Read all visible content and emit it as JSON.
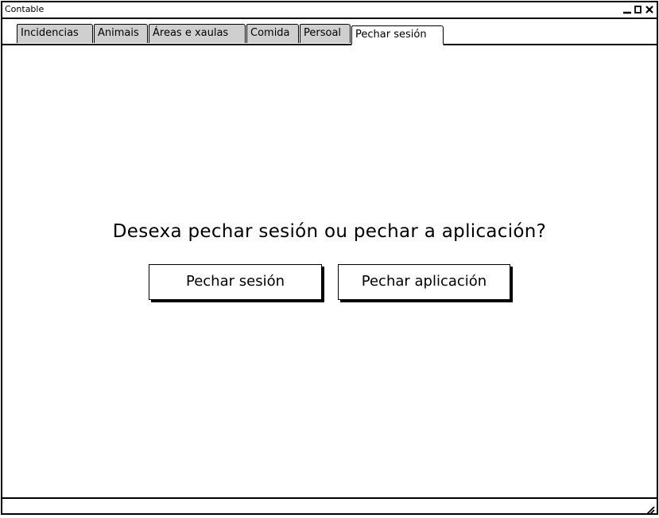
{
  "window": {
    "title": "Contable"
  },
  "window_controls": {
    "minimize_icon": "minimize-icon",
    "maximize_icon": "maximize-icon",
    "close_icon": "close-icon"
  },
  "tabs": [
    {
      "label": "Incidencias",
      "active": false
    },
    {
      "label": "Animais",
      "active": false
    },
    {
      "label": "Áreas e xaulas",
      "active": false
    },
    {
      "label": "Comida",
      "active": false
    },
    {
      "label": "Persoal",
      "active": false
    },
    {
      "label": "Pechar sesión",
      "active": true
    }
  ],
  "main": {
    "question": "Desexa pechar sesión ou pechar a aplicación?",
    "logout_button": "Pechar sesión",
    "exit_button": "Pechar aplicación"
  },
  "statusbar": {
    "resize_icon": "resize-grip-icon"
  },
  "colors": {
    "inactive_tab": "#cfcfcf",
    "active_tab": "#ffffff",
    "border": "#000000"
  }
}
